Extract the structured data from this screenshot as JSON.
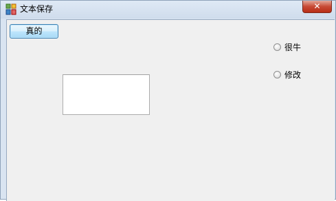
{
  "window": {
    "title": "文本保存",
    "close_label": "✕"
  },
  "controls": {
    "button_label": "真的",
    "text_input_value": "",
    "radio_options": [
      {
        "label": "很牛",
        "selected": false
      },
      {
        "label": "修改",
        "selected": false
      }
    ]
  }
}
